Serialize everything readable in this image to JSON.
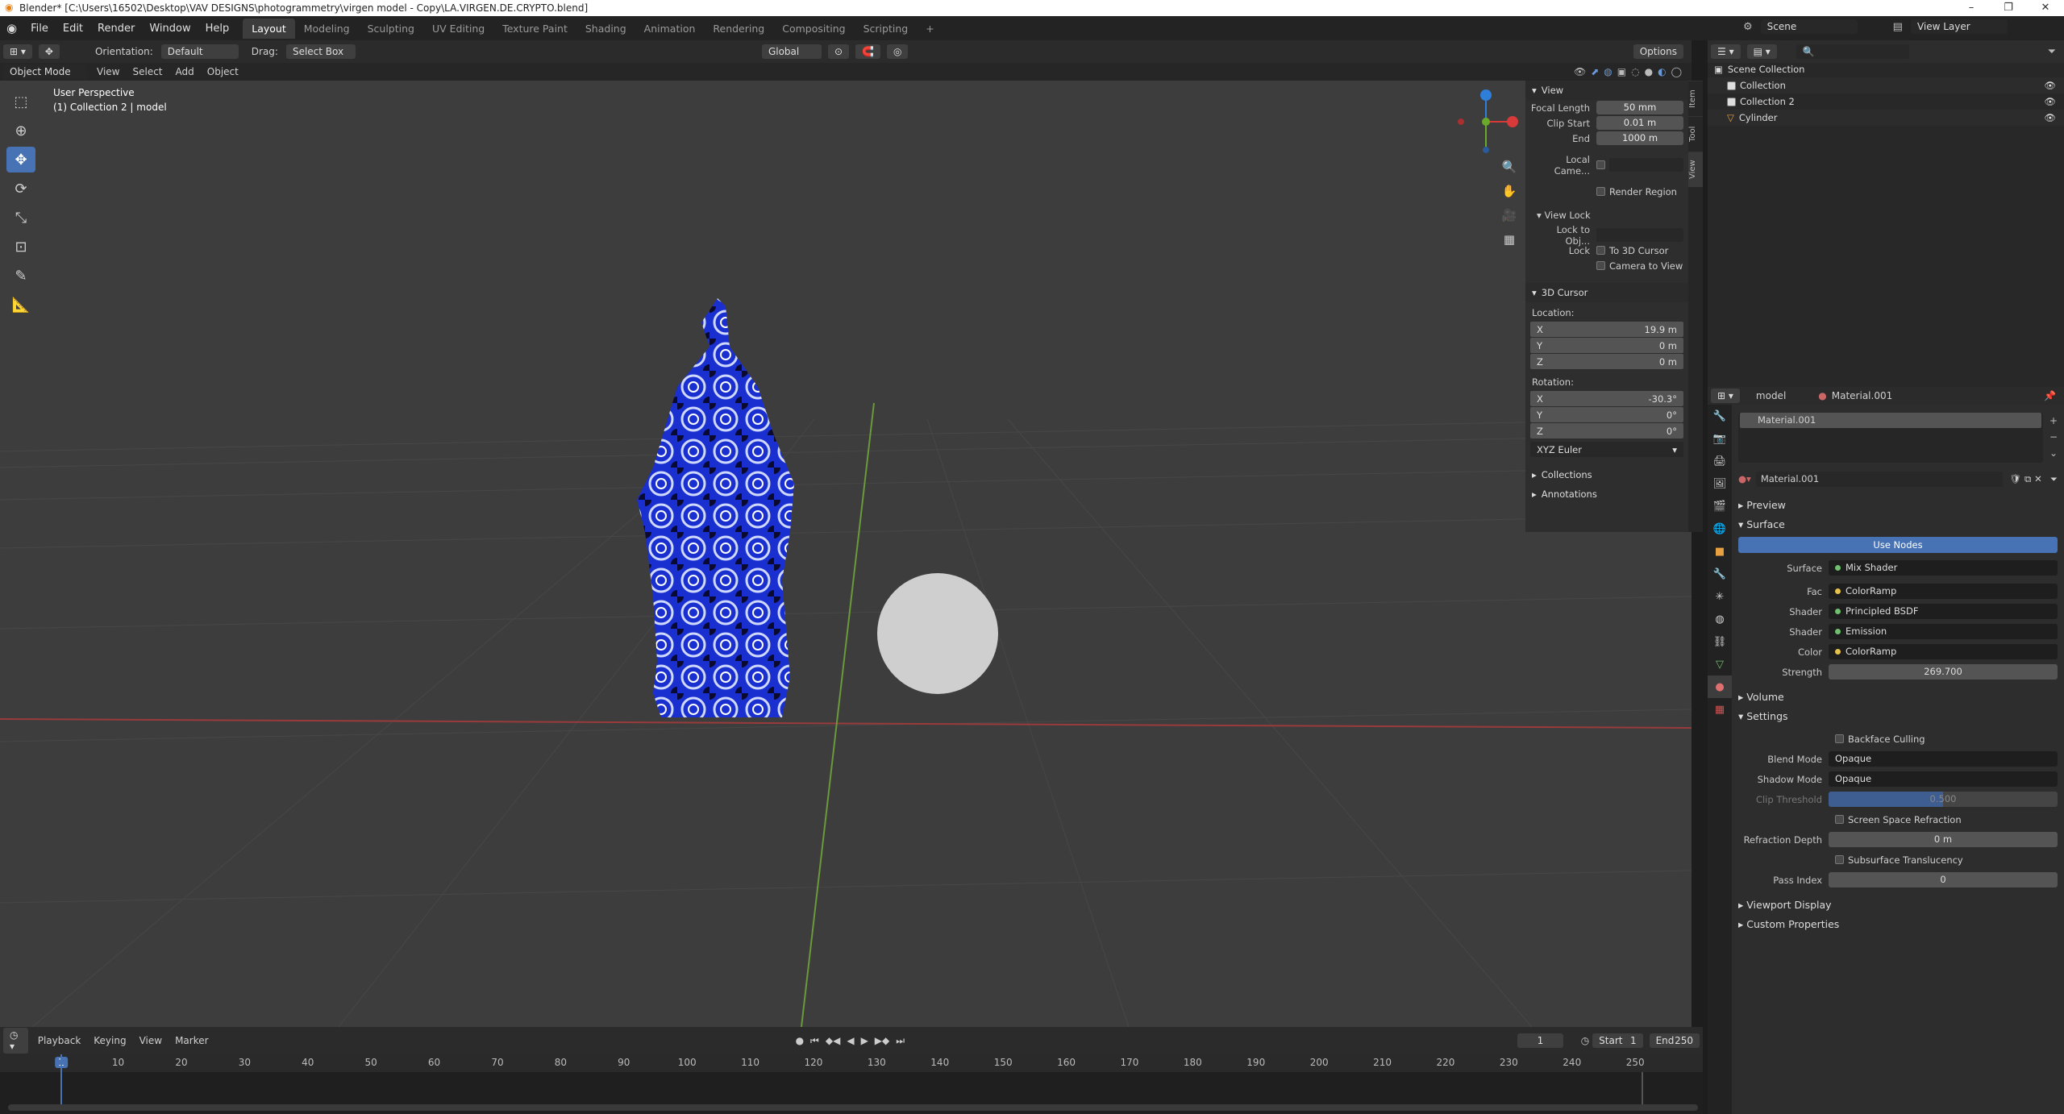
{
  "window": {
    "title": "Blender* [C:\\Users\\16502\\Desktop\\VAV DESIGNS\\photogrammetry\\virgen model - Copy\\LA.VIRGEN.DE.CRYPTO.blend]",
    "min": "–",
    "max": "❐",
    "close": "✕"
  },
  "menu": [
    "File",
    "Edit",
    "Render",
    "Window",
    "Help"
  ],
  "workspaces": [
    "Layout",
    "Modeling",
    "Sculpting",
    "UV Editing",
    "Texture Paint",
    "Shading",
    "Animation",
    "Rendering",
    "Compositing",
    "Scripting",
    "+"
  ],
  "header": {
    "orientation_label": "Orientation:",
    "orientation": "Default",
    "drag_label": "Drag:",
    "drag": "Select Box",
    "transform": "Global",
    "options": "Options"
  },
  "scene": {
    "scene_name": "Scene",
    "view_layer": "View Layer"
  },
  "viewport": {
    "mode": "Object Mode",
    "menus": [
      "View",
      "Select",
      "Add",
      "Object"
    ],
    "overlay1": "User Perspective",
    "overlay2": "(1) Collection 2 | model"
  },
  "npanel": {
    "tabs": [
      "Item",
      "Tool",
      "View"
    ],
    "view_section": "View",
    "focal_label": "Focal Length",
    "focal": "50 mm",
    "clip_start_label": "Clip Start",
    "clip_start": "0.01 m",
    "end_label": "End",
    "end": "1000 m",
    "local_camera": "Local Came...",
    "render_region": "Render Region",
    "view_lock": "View Lock",
    "lock_obj": "Lock to Obj...",
    "lock_label": "Lock",
    "to_cursor": "To 3D Cursor",
    "camera_to_view": "Camera to View",
    "cursor_section": "3D Cursor",
    "location": "Location:",
    "loc": [
      {
        "axis": "X",
        "value": "19.9 m"
      },
      {
        "axis": "Y",
        "value": "0 m"
      },
      {
        "axis": "Z",
        "value": "0 m"
      }
    ],
    "rotation": "Rotation:",
    "rot": [
      {
        "axis": "X",
        "value": "-30.3°"
      },
      {
        "axis": "Y",
        "value": "0°"
      },
      {
        "axis": "Z",
        "value": "0°"
      }
    ],
    "euler": "XYZ Euler",
    "collections": "Collections",
    "annotations": "Annotations"
  },
  "outliner": {
    "root": "Scene Collection",
    "items": [
      "Collection",
      "Collection 2",
      "Cylinder"
    ]
  },
  "properties": {
    "object": "model",
    "material": "Material.001",
    "slot": "Material.001",
    "mat_name": "Material.001",
    "preview": "Preview",
    "surface_sec": "Surface",
    "use_nodes": "Use Nodes",
    "rows": [
      {
        "label": "Surface",
        "value": "Mix Shader",
        "color": "#6fbf6f"
      },
      {
        "label": "Fac",
        "value": "ColorRamp",
        "color": "#e6c24a"
      },
      {
        "label": "Shader",
        "value": "Principled BSDF",
        "color": "#6fbf6f"
      },
      {
        "label": "Shader",
        "value": "Emission",
        "color": "#6fbf6f"
      },
      {
        "label": "Color",
        "value": "ColorRamp",
        "color": "#e6c24a"
      }
    ],
    "strength_label": "Strength",
    "strength": "269.700",
    "volume": "Volume",
    "settings": "Settings",
    "backface": "Backface Culling",
    "blend_label": "Blend Mode",
    "blend": "Opaque",
    "shadow_label": "Shadow Mode",
    "shadow": "Opaque",
    "clip_label": "Clip Threshold",
    "clip": "0.500",
    "ssr": "Screen Space Refraction",
    "refr_label": "Refraction Depth",
    "refr": "0 m",
    "sss": "Subsurface Translucency",
    "pass_label": "Pass Index",
    "pass": "0",
    "viewport_display": "Viewport Display",
    "custom_props": "Custom Properties"
  },
  "timeline": {
    "menus": [
      "Playback",
      "Keying",
      "View",
      "Marker"
    ],
    "current": "1",
    "start_label": "Start",
    "start": "1",
    "end_label": "End",
    "end": "250",
    "frames": [
      "1",
      "10",
      "20",
      "30",
      "40",
      "50",
      "60",
      "70",
      "80",
      "90",
      "100",
      "110",
      "120",
      "130",
      "140",
      "150",
      "160",
      "170",
      "180",
      "190",
      "200",
      "210",
      "220",
      "230",
      "240",
      "250"
    ]
  }
}
